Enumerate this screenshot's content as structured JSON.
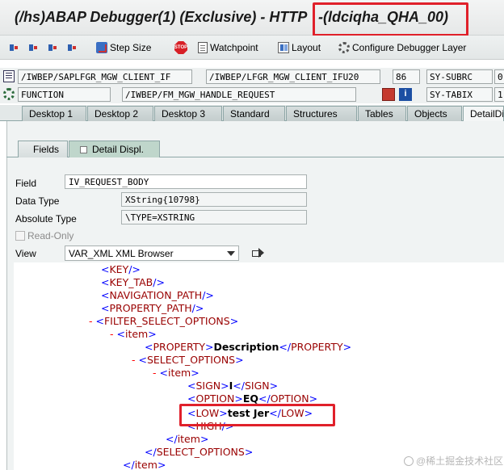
{
  "window": {
    "title": "(/hs)ABAP Debugger(1)  (Exclusive) - HTTP",
    "title_suffix": "-(ldciqha_QHA_00)"
  },
  "toolbar": {
    "step_size": "Step Size",
    "watchpoint": "Watchpoint",
    "layout": "Layout",
    "configure": "Configure Debugger Layer"
  },
  "status": {
    "row1": {
      "program": "/IWBEP/SAPLFGR_MGW_CLIENT_IF",
      "include": "/IWBEP/LFGR_MGW_CLIENT_IFU20",
      "line": "86",
      "sysvar": "SY-SUBRC",
      "sysval": "0"
    },
    "row2": {
      "type": "FUNCTION",
      "name": "/IWBEP/FM_MGW_HANDLE_REQUEST",
      "sysvar": "SY-TABIX",
      "sysval": "1"
    }
  },
  "tabs": [
    "Desktop 1",
    "Desktop 2",
    "Desktop 3",
    "Standard",
    "Structures",
    "Tables",
    "Objects",
    "DetailDi"
  ],
  "subtabs": [
    "Fields",
    "Detail Displ."
  ],
  "detail": {
    "field_label": "Field",
    "field_value": "IV_REQUEST_BODY",
    "datatype_label": "Data Type",
    "datatype_value": "XString{10798}",
    "abstype_label": "Absolute Type",
    "abstype_value": "\\TYPE=XSTRING",
    "readonly_label": "Read-Only",
    "view_label": "View",
    "view_value": "VAR_XML XML Browser"
  },
  "xml": {
    "key": "KEY",
    "key_tab": "KEY_TAB",
    "navigation_path": "NAVIGATION_PATH",
    "property_path": "PROPERTY_PATH",
    "filter_select_options": "FILTER_SELECT_OPTIONS",
    "item": "item",
    "property": "PROPERTY",
    "property_value": "Description",
    "select_options": "SELECT_OPTIONS",
    "sign": "SIGN",
    "sign_value": "I",
    "option": "OPTION",
    "option_value": "EQ",
    "low": "LOW",
    "low_value": "test Jer",
    "high": "HIGH"
  },
  "watermark": "@稀土掘金技术社区",
  "colors": {
    "highlight": "#e0202a",
    "xml_markup": "#0000ff",
    "xml_tag": "#990000",
    "collapse": "#ff0000"
  }
}
